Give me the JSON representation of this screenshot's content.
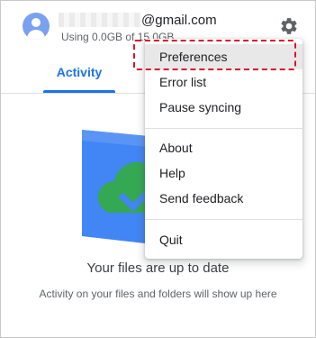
{
  "account": {
    "email_domain": "@gmail.com",
    "storage_text": "Using 0.0GB of 15.0GB"
  },
  "tabs": [
    {
      "label": "Activity",
      "active": true
    }
  ],
  "menu": {
    "items": [
      "Preferences",
      "Error list",
      "Pause syncing",
      "About",
      "Help",
      "Send feedback",
      "Quit"
    ],
    "selected": "Preferences",
    "highlight_color": "#d9152b"
  },
  "empty_state": {
    "title": "Your files are up to date",
    "subtitle": "Activity on your files and folders will show up here"
  },
  "colors": {
    "accent": "#1a73e8",
    "avatar": "#7aa1f0",
    "folder_blue": "#4285f4",
    "cloud_green": "#34a853"
  },
  "icons": [
    "avatar-icon",
    "gear-icon",
    "cloud-check-icon"
  ]
}
